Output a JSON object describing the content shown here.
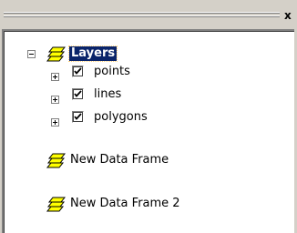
{
  "window": {
    "close_label": "x"
  },
  "tree": {
    "root": {
      "label": "Layers",
      "expanded": true,
      "selected": true,
      "icon": "layers-stack-icon"
    },
    "layers": [
      {
        "label": "points",
        "checked": true,
        "expanded": false
      },
      {
        "label": "lines",
        "checked": true,
        "expanded": false
      },
      {
        "label": "polygons",
        "checked": true,
        "expanded": false
      }
    ],
    "data_frames": [
      {
        "label": "New Data Frame",
        "icon": "layers-stack-icon"
      },
      {
        "label": "New Data Frame 2",
        "icon": "layers-stack-icon"
      }
    ]
  },
  "colors": {
    "selection": "#0a246a",
    "icon_yellow": "#ffff00",
    "panel_bg": "#ffffff",
    "chrome_bg": "#d4d0c8"
  }
}
